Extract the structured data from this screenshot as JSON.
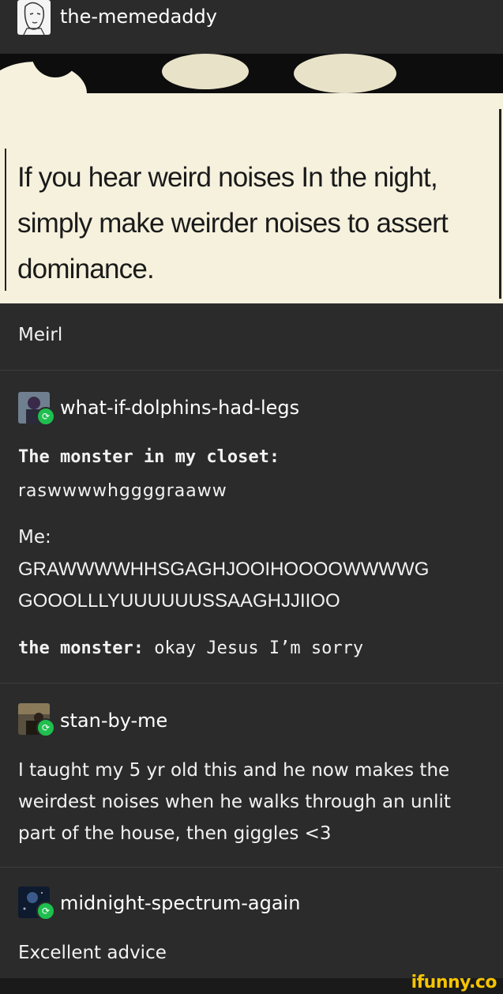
{
  "colors": {
    "background": "#2b2b2c",
    "text": "#f2f2f2",
    "quote_bg": "#f5f1dd",
    "reblog_green": "#1fbf4f",
    "watermark": "#f5c400"
  },
  "original_post": {
    "username": "the-memedaddy",
    "avatar_icon": "sketch-face-icon",
    "quote_lines": [
      "If you hear weird noises In the night,",
      "simply make weirder noises to assert",
      "dominance."
    ],
    "caption": "Meirl"
  },
  "reblogs": [
    {
      "username": "what-if-dolphins-had-legs",
      "avatar_icon": "character-avatar-icon",
      "badge_icon": "reblog-icon",
      "line1_label": "The monster in my closet:",
      "line2": "raswwwwhggggraaww",
      "line3": "Me:",
      "line4": "GRAWWWWHHSGAGHJOOIHOOOOWWWWG",
      "line5": "GOOOLLLYUUUUUUSSAAGHJJIIOO",
      "line6_label": "the monster:",
      "line6_text": "okay Jesus I’m sorry"
    },
    {
      "username": "stan-by-me",
      "avatar_icon": "photo-avatar-icon",
      "badge_icon": "reblog-icon",
      "text": "I taught my 5 yr old this and he now makes the weirdest noises when he walks through an unlit part of the house, then giggles <3"
    },
    {
      "username": "midnight-spectrum-again",
      "avatar_icon": "night-sky-avatar-icon",
      "badge_icon": "reblog-icon",
      "text": "Excellent advice"
    }
  ],
  "watermark": "ifunny.co"
}
